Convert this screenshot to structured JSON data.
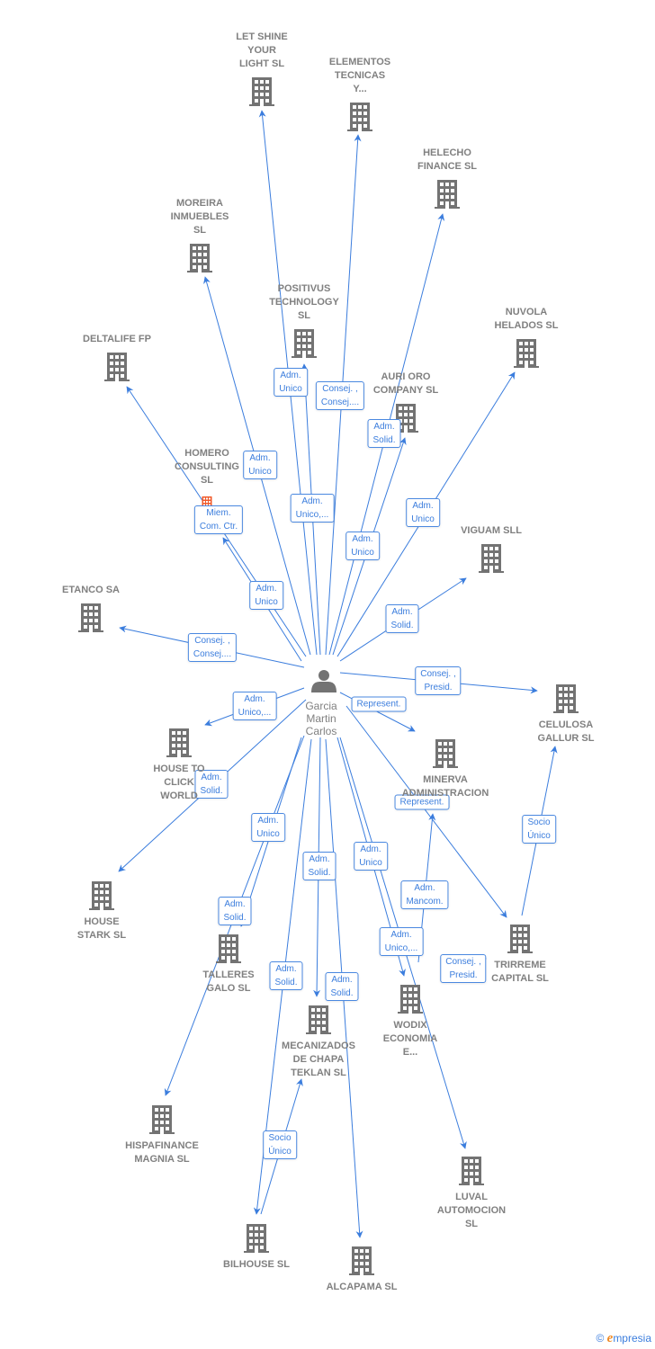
{
  "center": {
    "id": "garcia",
    "name_lines": [
      "Garcia",
      "Martin",
      "Carlos"
    ],
    "icon": "person-icon"
  },
  "colors": {
    "edge": "#3b7ddd",
    "node": "#737373",
    "highlight": "#f0592a",
    "label_text": "#808080"
  },
  "nodes": [
    {
      "id": "letshine",
      "lines": [
        "LET SHINE",
        "YOUR",
        "LIGHT  SL"
      ],
      "icon": "building-icon"
    },
    {
      "id": "elementos",
      "lines": [
        "ELEMENTOS",
        "TECNICAS",
        "Y..."
      ],
      "icon": "building-icon"
    },
    {
      "id": "helecho",
      "lines": [
        "HELECHO",
        "FINANCE  SL"
      ],
      "icon": "building-icon"
    },
    {
      "id": "moreira",
      "lines": [
        "MOREIRA",
        "INMUEBLES",
        "SL"
      ],
      "icon": "building-icon"
    },
    {
      "id": "positivus",
      "lines": [
        "POSITIVUS",
        "TECHNOLOGY",
        "SL"
      ],
      "icon": "building-icon"
    },
    {
      "id": "nuvola",
      "lines": [
        "NUVOLA",
        "HELADOS SL"
      ],
      "icon": "building-icon"
    },
    {
      "id": "deltalife",
      "lines": [
        "DELTALIFE FP"
      ],
      "icon": "building-icon"
    },
    {
      "id": "aurioro",
      "lines": [
        "AURI  ORO",
        "COMPANY SL"
      ],
      "icon": "building-icon"
    },
    {
      "id": "homero",
      "lines": [
        "HOMERO",
        "CONSULTING",
        "SL"
      ],
      "icon": "building-icon",
      "highlighted": true
    },
    {
      "id": "viguam",
      "lines": [
        "VIGUAM  SLL"
      ],
      "icon": "building-icon"
    },
    {
      "id": "etanco",
      "lines": [
        "ETANCO SA"
      ],
      "icon": "building-icon"
    },
    {
      "id": "celulosa",
      "lines": [
        "CELULOSA",
        "GALLUR SL"
      ],
      "icon": "building-icon"
    },
    {
      "id": "housetoclick",
      "lines": [
        "HOUSE TO",
        "CLICK",
        "WORLD"
      ],
      "icon": "building-icon"
    },
    {
      "id": "minerva",
      "lines": [
        "MINERVA",
        "ADMINISTRACION"
      ],
      "icon": "building-icon"
    },
    {
      "id": "housestark",
      "lines": [
        "HOUSE",
        "STARK  SL"
      ],
      "icon": "building-icon"
    },
    {
      "id": "trirreme",
      "lines": [
        "TRIRREME",
        "CAPITAL  SL"
      ],
      "icon": "building-icon"
    },
    {
      "id": "talleres",
      "lines": [
        "TALLERES",
        "GALO SL"
      ],
      "icon": "building-icon"
    },
    {
      "id": "wodix",
      "lines": [
        "WODIX",
        "ECONOMIA",
        "E..."
      ],
      "icon": "building-icon"
    },
    {
      "id": "mecanizados",
      "lines": [
        "MECANIZADOS",
        "DE CHAPA",
        "TEKLAN  SL"
      ],
      "icon": "building-icon"
    },
    {
      "id": "hispafinance",
      "lines": [
        "HISPAFINANCE",
        "MAGNIA  SL"
      ],
      "icon": "building-icon"
    },
    {
      "id": "luval",
      "lines": [
        "LUVAL",
        "AUTOMOCION",
        "SL"
      ],
      "icon": "building-icon"
    },
    {
      "id": "bilhouse",
      "lines": [
        "BILHOUSE  SL"
      ],
      "icon": "building-icon"
    },
    {
      "id": "alcapama",
      "lines": [
        "ALCAPAMA SL"
      ],
      "icon": "building-icon"
    }
  ],
  "edges": [
    {
      "from": "garcia",
      "to": "letshine",
      "role": [
        "Adm.",
        "Unico,..."
      ]
    },
    {
      "from": "garcia",
      "to": "elementos",
      "role": [
        "Consej. ,",
        "Consej...."
      ]
    },
    {
      "from": "garcia",
      "to": "helecho",
      "role": [
        "Adm.",
        "Solid."
      ]
    },
    {
      "from": "garcia",
      "to": "moreira",
      "role": [
        "Adm.",
        "Unico"
      ]
    },
    {
      "from": "garcia",
      "to": "positivus",
      "role": [
        "Adm.",
        "Unico"
      ]
    },
    {
      "from": "garcia",
      "to": "nuvola",
      "role": [
        "Adm.",
        "Unico"
      ]
    },
    {
      "from": "garcia",
      "to": "aurioro",
      "role": [
        "Adm.",
        "Unico"
      ]
    },
    {
      "from": "garcia",
      "to": "deltalife",
      "role": [
        "Miem.",
        "Com. Ctr."
      ]
    },
    {
      "from": "garcia",
      "to": "homero",
      "role": [
        "Adm.",
        "Unico"
      ]
    },
    {
      "from": "garcia",
      "to": "viguam",
      "role": [
        "Adm.",
        "Solid."
      ]
    },
    {
      "from": "garcia",
      "to": "etanco",
      "role": [
        "Consej. ,",
        "Consej...."
      ]
    },
    {
      "from": "garcia",
      "to": "celulosa",
      "role": [
        "Consej. ,",
        "Presid."
      ]
    },
    {
      "from": "garcia",
      "to": "housetoclick",
      "role": [
        "Adm.",
        "Unico,..."
      ]
    },
    {
      "from": "garcia",
      "to": "minerva",
      "role": [
        "Represent."
      ]
    },
    {
      "from": "garcia",
      "to": "housestark",
      "role": [
        "Adm.",
        "Solid."
      ]
    },
    {
      "from": "garcia",
      "to": "trirreme",
      "role": [
        "Represent."
      ]
    },
    {
      "from": "trirreme",
      "to": "celulosa",
      "role": [
        "Socio",
        "Único"
      ]
    },
    {
      "from": "wodix",
      "to": "minerva",
      "role": [
        "Adm.",
        "Mancom."
      ]
    },
    {
      "from": "garcia",
      "to": "wodix",
      "role": [
        "Adm.",
        "Unico,..."
      ]
    },
    {
      "from": "wodix",
      "to": "trirreme",
      "role": [
        "Consej. ,",
        "Presid."
      ]
    },
    {
      "from": "garcia",
      "to": "luval",
      "role": [
        "Adm.",
        "Unico"
      ]
    },
    {
      "from": "garcia",
      "to": "talleres",
      "role": [
        "Adm.",
        "Unico"
      ]
    },
    {
      "from": "garcia",
      "to": "hispafinance",
      "role": [
        "Adm.",
        "Solid."
      ]
    },
    {
      "from": "garcia",
      "to": "mecanizados",
      "role": [
        "Adm.",
        "Solid."
      ]
    },
    {
      "from": "garcia",
      "to": "bilhouse",
      "role": [
        "Adm.",
        "Solid."
      ]
    },
    {
      "from": "bilhouse",
      "to": "mecanizados",
      "role": [
        "Socio",
        "Único"
      ]
    },
    {
      "from": "garcia",
      "to": "alcapama",
      "role": [
        "Adm.",
        "Solid."
      ]
    }
  ],
  "footer": {
    "copyright": "©",
    "brand_initial": "e",
    "brand_rest": "mpresia"
  }
}
